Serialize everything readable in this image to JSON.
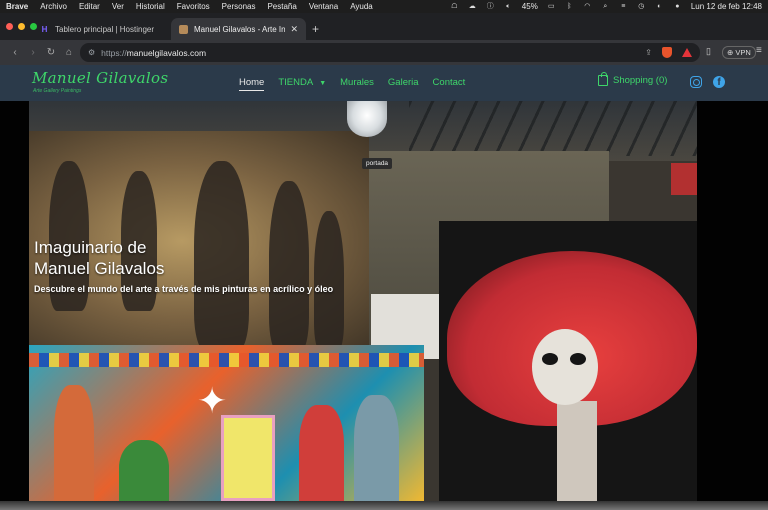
{
  "menubar": {
    "app": "Brave",
    "items": [
      "Archivo",
      "Editar",
      "Ver",
      "Historial",
      "Favoritos",
      "Personas",
      "Pestaña",
      "Ventana",
      "Ayuda"
    ],
    "battery": "45%",
    "datetime": "Lun 12 de feb  12:48"
  },
  "tabs": [
    {
      "title": "Tablero principal | Hostinger",
      "icon": "hostinger-icon"
    },
    {
      "title": "Manuel Gilavalos - Arte Inspir",
      "icon": "site-favicon"
    }
  ],
  "address": {
    "scheme": "https://",
    "host": "manuelgilavalos.com",
    "vpn_label": "VPN"
  },
  "site": {
    "logo": "Manuel Gilavalos",
    "tagline": "Arte Gallery Paintings",
    "nav": [
      "Home",
      "TIENDA",
      "Murales",
      "Galeria",
      "Contact"
    ],
    "cart_label": "Shopping (0)",
    "brand_color": "#3ed66a",
    "header_bg": "#2b3a4a",
    "social_color": "#3fa4e8"
  },
  "hero": {
    "tooltip": "portada",
    "title_line1": "Imaguinario de",
    "title_line2": "Manuel Gilavalos",
    "subtitle": "Descubre el mundo del arte a través de mis pinturas en acrílico y óleo"
  }
}
